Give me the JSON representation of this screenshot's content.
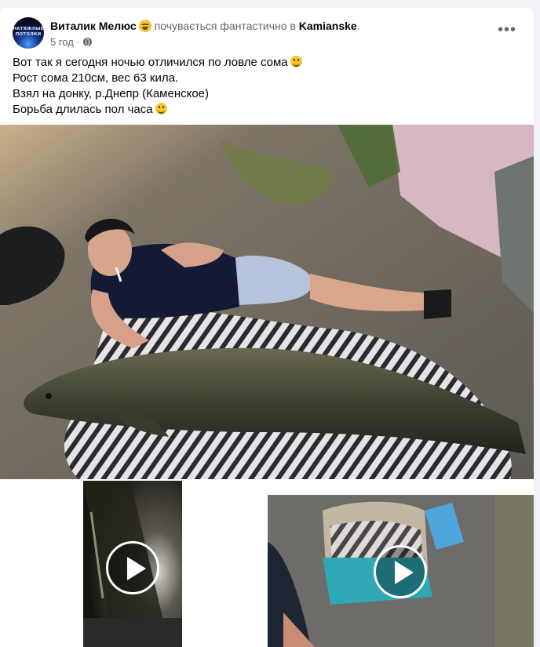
{
  "post": {
    "author": "Виталик Мелюс",
    "feeling": "почувається фантастично в",
    "location": "Kamianske",
    "location_suffix": ".",
    "time": "5 год",
    "separator": "·",
    "more_label": "•••",
    "avatar_text_line1": "НАТЯЖНЫЕ",
    "avatar_text_line2": "ПОТОЛКИ",
    "text_lines": [
      "Вот так я сегодня ночью отличился по ловле сома",
      "Рост сома 210см, вес 63 кила.",
      "Взял на донку, р.Днепр (Каменское)",
      "Борьба длилась пол часа"
    ]
  },
  "icons": {
    "feeling": "grinning-face-icon",
    "privacy": "globe-icon",
    "more": "more-options-icon",
    "smile": "smiling-face-icon",
    "play": "play-icon"
  },
  "media": [
    {
      "kind": "photo",
      "description_icon": "main-photo"
    },
    {
      "kind": "video"
    },
    {
      "kind": "video"
    }
  ],
  "colors": {
    "background": "#f0f2f5",
    "card": "#ffffff",
    "secondary_text": "#65676b",
    "primary_text": "#050505"
  }
}
